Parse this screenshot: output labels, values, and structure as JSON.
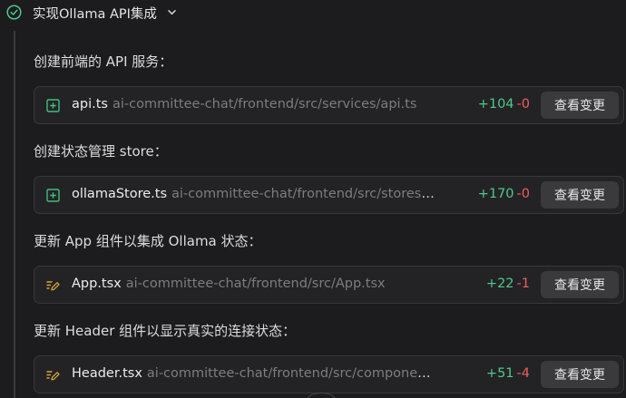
{
  "task": {
    "title": "实现Ollama API集成",
    "status_icon": "check-circle-icon",
    "expand_icon": "chevron-down-icon"
  },
  "colors": {
    "background": "#1c1c1e",
    "card": "#232325",
    "added": "#4ec98c",
    "removed": "#ef5d5d",
    "new_file_icon": "#3fbf7f",
    "edit_file_icon": "#d9a33b"
  },
  "steps": [
    {
      "label": "创建前端的 API 服务：",
      "file": {
        "icon": "file-add-icon",
        "name": "api.ts",
        "path": "ai-committee-chat/frontend/src/services/api.ts",
        "additions": "+104",
        "deletions": "-0",
        "action_label": "查看变更"
      }
    },
    {
      "label": "创建状态管理 store：",
      "file": {
        "icon": "file-add-icon",
        "name": "ollamaStore.ts",
        "path": "ai-committee-chat/frontend/src/stores/ollam...",
        "additions": "+170",
        "deletions": "-0",
        "action_label": "查看变更"
      }
    },
    {
      "label": "更新 App 组件以集成 Ollama 状态：",
      "file": {
        "icon": "file-edit-icon",
        "name": "App.tsx",
        "path": "ai-committee-chat/frontend/src/App.tsx",
        "additions": "+22",
        "deletions": "-1",
        "action_label": "查看变更"
      }
    },
    {
      "label": "更新 Header 组件以显示真实的连接状态：",
      "file": {
        "icon": "file-edit-icon",
        "name": "Header.tsx",
        "path": "ai-committee-chat/frontend/src/components/layo...",
        "additions": "+51",
        "deletions": "-4",
        "action_label": "查看变更"
      }
    }
  ]
}
